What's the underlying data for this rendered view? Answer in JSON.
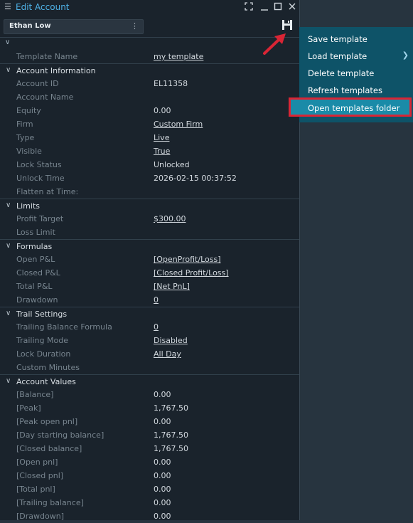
{
  "window": {
    "title": "Edit Account",
    "controls": [
      "fullscreen-icon",
      "minimize-icon",
      "maximize-icon",
      "close-icon"
    ]
  },
  "account_selector": {
    "value": "Ethan Low"
  },
  "template_row": {
    "label": "Template Name",
    "value": "my template"
  },
  "sections": [
    {
      "title": "Account Information",
      "rows": [
        {
          "label": "Account ID",
          "value": "EL11358",
          "link": false
        },
        {
          "label": "Account Name",
          "value": "",
          "link": false
        },
        {
          "label": "Equity",
          "value": "0.00",
          "link": false
        },
        {
          "label": "Firm",
          "value": "Custom Firm",
          "link": true
        },
        {
          "label": "Type",
          "value": "Live",
          "link": true
        },
        {
          "label": "Visible",
          "value": "True",
          "link": true
        },
        {
          "label": "Lock Status",
          "value": "Unlocked",
          "link": false
        },
        {
          "label": "Unlock Time",
          "value": "2026-02-15 00:37:52",
          "link": false
        },
        {
          "label": "Flatten at Time:",
          "value": "",
          "link": false
        }
      ]
    },
    {
      "title": "Limits",
      "rows": [
        {
          "label": "Profit Target",
          "value": "$300.00",
          "link": true
        },
        {
          "label": "Loss Limit",
          "value": "",
          "link": false
        }
      ]
    },
    {
      "title": "Formulas",
      "rows": [
        {
          "label": "Open P&L",
          "value": "[OpenProfit/Loss]",
          "link": true
        },
        {
          "label": "Closed P&L",
          "value": "[Closed Profit/Loss]",
          "link": true
        },
        {
          "label": "Total P&L",
          "value": "[Net PnL]",
          "link": true
        },
        {
          "label": "Drawdown",
          "value": "0",
          "link": true
        }
      ]
    },
    {
      "title": "Trail Settings",
      "rows": [
        {
          "label": "Trailing Balance Formula",
          "value": "0",
          "link": true
        },
        {
          "label": "Trailing Mode",
          "value": "Disabled",
          "link": true
        },
        {
          "label": "Lock Duration",
          "value": "All Day",
          "link": true
        },
        {
          "label": "Custom Minutes",
          "value": "",
          "link": false
        }
      ]
    },
    {
      "title": "Account Values",
      "rows": [
        {
          "label": "[Balance]",
          "value": "0.00",
          "link": false
        },
        {
          "label": "[Peak]",
          "value": "1,767.50",
          "link": false
        },
        {
          "label": "[Peak open pnl]",
          "value": "0.00",
          "link": false
        },
        {
          "label": "[Day starting balance]",
          "value": "1,767.50",
          "link": false
        },
        {
          "label": "[Closed balance]",
          "value": "1,767.50",
          "link": false
        },
        {
          "label": "[Open pnl]",
          "value": "0.00",
          "link": false
        },
        {
          "label": "[Closed pnl]",
          "value": "0.00",
          "link": false
        },
        {
          "label": "[Total pnl]",
          "value": "0.00",
          "link": false
        },
        {
          "label": "[Trailing balance]",
          "value": "0.00",
          "link": false
        },
        {
          "label": "[Drawdown]",
          "value": "0.00",
          "link": false
        }
      ]
    }
  ],
  "template_menu": {
    "items": [
      {
        "label": "Save template",
        "has_submenu": false
      },
      {
        "label": "Load template",
        "has_submenu": true
      },
      {
        "label": "Delete template",
        "has_submenu": false
      },
      {
        "label": "Refresh templates",
        "has_submenu": false
      },
      {
        "label": "Open templates folder",
        "has_submenu": false,
        "highlighted": true
      }
    ]
  },
  "colors": {
    "accent": "#4fb3e8",
    "menu_bg": "#0e5368",
    "menu_highlight": "#1a8ba8",
    "annotation": "#d92535"
  }
}
